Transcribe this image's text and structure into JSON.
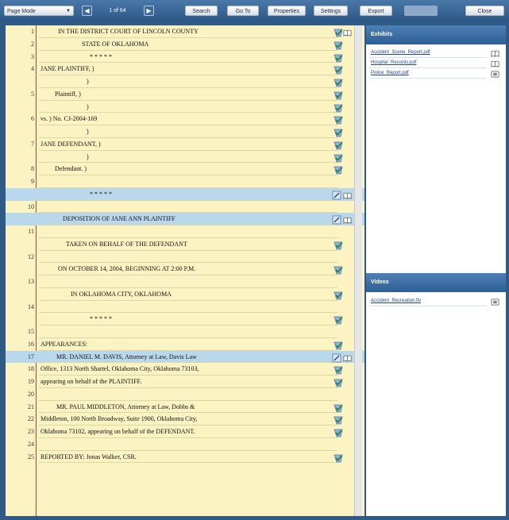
{
  "toolbar": {
    "page_mode_label": "Page Mode",
    "page_indicator": "1 of 64",
    "search_label": "Search",
    "goto_label": "Go To",
    "properties_label": "Properties",
    "settings_label": "Settings",
    "export_label": "Export",
    "close_label": "Close"
  },
  "transcript": {
    "lines": [
      {
        "num": "1",
        "text": "IN THE DISTRICT COURT OF LINCOLN COUNTY",
        "indent": 24,
        "hl": false,
        "icon": "check"
      },
      {
        "num": "2",
        "text": "STATE OF OKLAHOMA",
        "indent": 54,
        "hl": false,
        "icon": "check"
      },
      {
        "num": "3",
        "text": "* * * * *",
        "indent": 64,
        "hl": false,
        "icon": "check"
      },
      {
        "num": "4",
        "text": "JANE PLAINTIFF,                )",
        "indent": 2,
        "hl": false,
        "icon": "check"
      },
      {
        "num": "",
        "text": ")",
        "indent": 60,
        "hl": false,
        "icon": "check"
      },
      {
        "num": "5",
        "text": "Plaintiff,          )",
        "indent": 20,
        "hl": false,
        "icon": "check"
      },
      {
        "num": "",
        "text": ")",
        "indent": 60,
        "hl": false,
        "icon": "check"
      },
      {
        "num": "6",
        "text": "vs.                          ) No. CJ-2004-169",
        "indent": 2,
        "hl": false,
        "icon": "check"
      },
      {
        "num": "",
        "text": ")",
        "indent": 60,
        "hl": false,
        "icon": "check"
      },
      {
        "num": "7",
        "text": "JANE DEFENDANT,            )",
        "indent": 2,
        "hl": false,
        "icon": "check"
      },
      {
        "num": "",
        "text": ")",
        "indent": 60,
        "hl": false,
        "icon": "check"
      },
      {
        "num": "8",
        "text": "Defendant.          )",
        "indent": 20,
        "hl": false,
        "icon": "check"
      },
      {
        "num": "9",
        "text": "",
        "indent": 0,
        "hl": false,
        "icon": ""
      },
      {
        "num": "",
        "text": "* * * * *",
        "indent": 64,
        "hl": true,
        "icon": "edit"
      },
      {
        "num": "10",
        "text": "",
        "indent": 0,
        "hl": false,
        "icon": ""
      },
      {
        "num": "",
        "text": "DEPOSITION OF JANE ANN PLAINTIFF",
        "indent": 30,
        "hl": true,
        "icon": "edit"
      },
      {
        "num": "11",
        "text": "",
        "indent": 0,
        "hl": false,
        "icon": ""
      },
      {
        "num": "",
        "text": "TAKEN ON BEHALF OF THE DEFENDANT",
        "indent": 34,
        "hl": false,
        "icon": "check"
      },
      {
        "num": "12",
        "text": "",
        "indent": 0,
        "hl": false,
        "icon": ""
      },
      {
        "num": "",
        "text": "ON OCTOBER 14, 2004, BEGINNING AT 2:00 P.M.",
        "indent": 24,
        "hl": false,
        "icon": "check"
      },
      {
        "num": "13",
        "text": "",
        "indent": 0,
        "hl": false,
        "icon": ""
      },
      {
        "num": "",
        "text": "IN OKLAHOMA CITY, OKLAHOMA",
        "indent": 40,
        "hl": false,
        "icon": "check"
      },
      {
        "num": "14",
        "text": "",
        "indent": 0,
        "hl": false,
        "icon": ""
      },
      {
        "num": "",
        "text": "* * * * *",
        "indent": 64,
        "hl": false,
        "icon": "check"
      },
      {
        "num": "15",
        "text": "",
        "indent": 0,
        "hl": false,
        "icon": ""
      },
      {
        "num": "16",
        "text": "APPEARANCES:",
        "indent": 2,
        "hl": false,
        "icon": "check"
      },
      {
        "num": "17",
        "text": "MR. DANIEL M. DAVIS, Attorney at Law, Davis Law",
        "indent": 22,
        "hl": true,
        "icon": "edit"
      },
      {
        "num": "18",
        "text": "Office, 1313 North Shartel, Oklahoma City, Oklahoma 73103,",
        "indent": 2,
        "hl": false,
        "icon": "check"
      },
      {
        "num": "19",
        "text": "appearing on behalf of the PLAINTIFF.",
        "indent": 2,
        "hl": false,
        "icon": "check"
      },
      {
        "num": "20",
        "text": "",
        "indent": 0,
        "hl": false,
        "icon": ""
      },
      {
        "num": "21",
        "text": "MR. PAUL MIDDLETON, Attorney at Law, Dobbs &",
        "indent": 22,
        "hl": false,
        "icon": "check"
      },
      {
        "num": "22",
        "text": "Middleton, 100 North Broadway, Suite 1900, Oklahoma City,",
        "indent": 2,
        "hl": false,
        "icon": "check"
      },
      {
        "num": "23",
        "text": "Oklahoma 73102, appearing on behalf of the DEFENDANT.",
        "indent": 2,
        "hl": false,
        "icon": "check"
      },
      {
        "num": "24",
        "text": "",
        "indent": 0,
        "hl": false,
        "icon": ""
      },
      {
        "num": "25",
        "text": "REPORTED BY: Jonas Walker, CSR.",
        "indent": 2,
        "hl": false,
        "icon": "check"
      }
    ]
  },
  "exhibits": {
    "title": "Exhibits",
    "items": [
      {
        "label": "Accident_Scene_Report.pdf",
        "icon": "book"
      },
      {
        "label": "Hospital_Records.pdf",
        "icon": "book"
      },
      {
        "label": "Police_Report.pdf",
        "icon": "film"
      }
    ]
  },
  "videos": {
    "title": "Videos",
    "items": [
      {
        "label": "Accident_Recreation.flv",
        "icon": "film"
      }
    ]
  }
}
